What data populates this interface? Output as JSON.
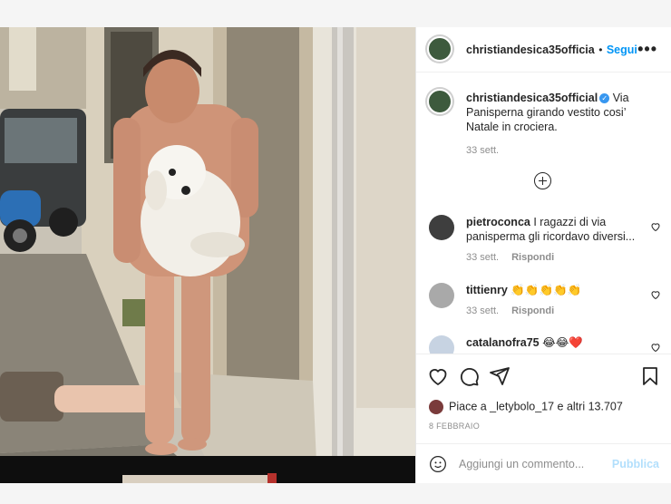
{
  "post": {
    "username": "christiandesica35officia",
    "follow_label": "Segui",
    "separator": "•",
    "more_label": "•••"
  },
  "caption": {
    "username": "christiandesica35official",
    "verified": "✓",
    "text": "Via Panisperna girando vestito cosi’ Natale in crociera.",
    "time": "33 sett."
  },
  "comments": [
    {
      "username": "pietroconca",
      "text": "I ragazzi di via panisperma gli ricordavo diversi...",
      "time": "33 sett.",
      "reply": "Rispondi"
    },
    {
      "username": "tittienry",
      "text": "👏👏👏👏👏",
      "time": "33 sett.",
      "reply": "Rispondi"
    },
    {
      "username": "catalanofra75",
      "text": "😂😂❤️"
    }
  ],
  "likes": {
    "text": "Piace a _letybolo_17 e altri 13.707"
  },
  "date": "8 FEBBRAIO",
  "add_comment": {
    "placeholder": "Aggiungi un commento...",
    "publish": "Pubblica"
  },
  "colors": {
    "accent": "#0095f6",
    "publish_disabled": "#b2dffc",
    "verified": "#3897f0"
  },
  "icons": [
    "more-icon",
    "add-icon",
    "heart-icon",
    "comment-icon",
    "share-icon",
    "bookmark-icon",
    "smile-icon"
  ]
}
